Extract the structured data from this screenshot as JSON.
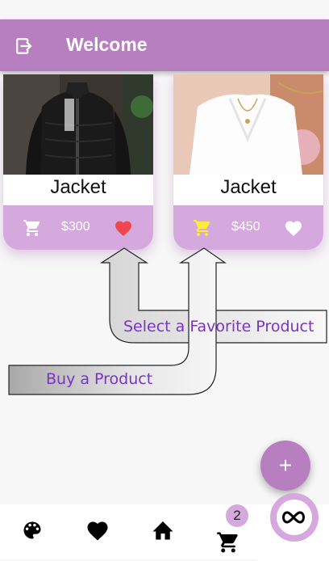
{
  "app": {
    "title": "Welcome"
  },
  "products": [
    {
      "name": "Jacket",
      "price": "$300",
      "favorite": true,
      "cart_color": "#ffffff",
      "heart_color": "#f0474f"
    },
    {
      "name": "Jacket",
      "price": "$450",
      "favorite": false,
      "cart_color": "#ffeb3b",
      "heart_color": "#ffffff"
    }
  ],
  "annotations": {
    "favorite": "Select a Favorite Product",
    "buy": "Buy a Product"
  },
  "fab": {
    "label": "+"
  },
  "bottom_nav": {
    "items": [
      "palette-icon",
      "heart-icon",
      "home-icon",
      "cart-icon",
      "infinity-icon"
    ],
    "cart_badge": "2",
    "active": "infinity-icon"
  },
  "colors": {
    "primary": "#b77fc0",
    "light": "#d5a9dd",
    "annotation_text": "#7a34c2"
  }
}
